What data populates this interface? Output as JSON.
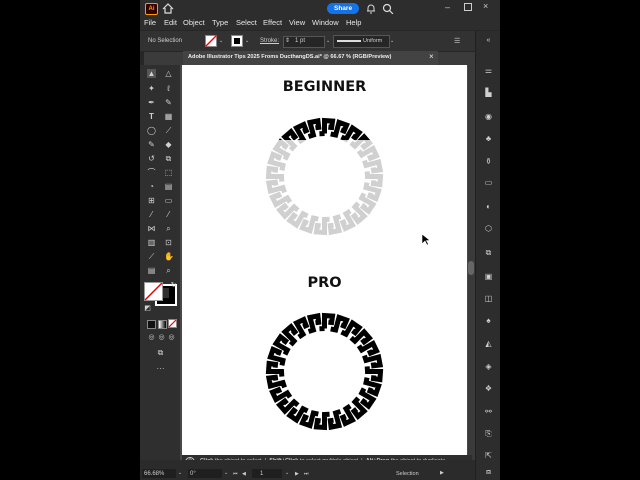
{
  "app": {
    "logo": "Ai",
    "share_label": "Share"
  },
  "menu": [
    "File",
    "Edit",
    "Object",
    "Type",
    "Select",
    "Effect",
    "View",
    "Window",
    "Help"
  ],
  "control": {
    "selection_label": "No Selection",
    "stroke_label": "Stroke:",
    "stroke_value": "1 pt",
    "profile_label": "Uniform"
  },
  "document": {
    "tab_title": "Adobe Illustrator Tips 2025 Froms DucthangDS.ai* @ 66.67 % (RGB/Preview)",
    "close_glyph": "×"
  },
  "artboard": {
    "heading_top": "BEGINNER",
    "heading_bottom": "PRO"
  },
  "tip": {
    "text1": "Click",
    "text2": "the object to select",
    "text3": "Shift+Click",
    "text4": "to select multiple object",
    "text5": "Alt+Drag",
    "text6": "the object to duplicate"
  },
  "status": {
    "zoom": "66.68%",
    "rotate": "0°",
    "page": "1",
    "mode": "Selection"
  },
  "colors": {
    "accent": "#1473e6",
    "beginner_ring": "#d0d0d0",
    "beginner_highlight": "#000000",
    "pro_ring": "#000000"
  }
}
